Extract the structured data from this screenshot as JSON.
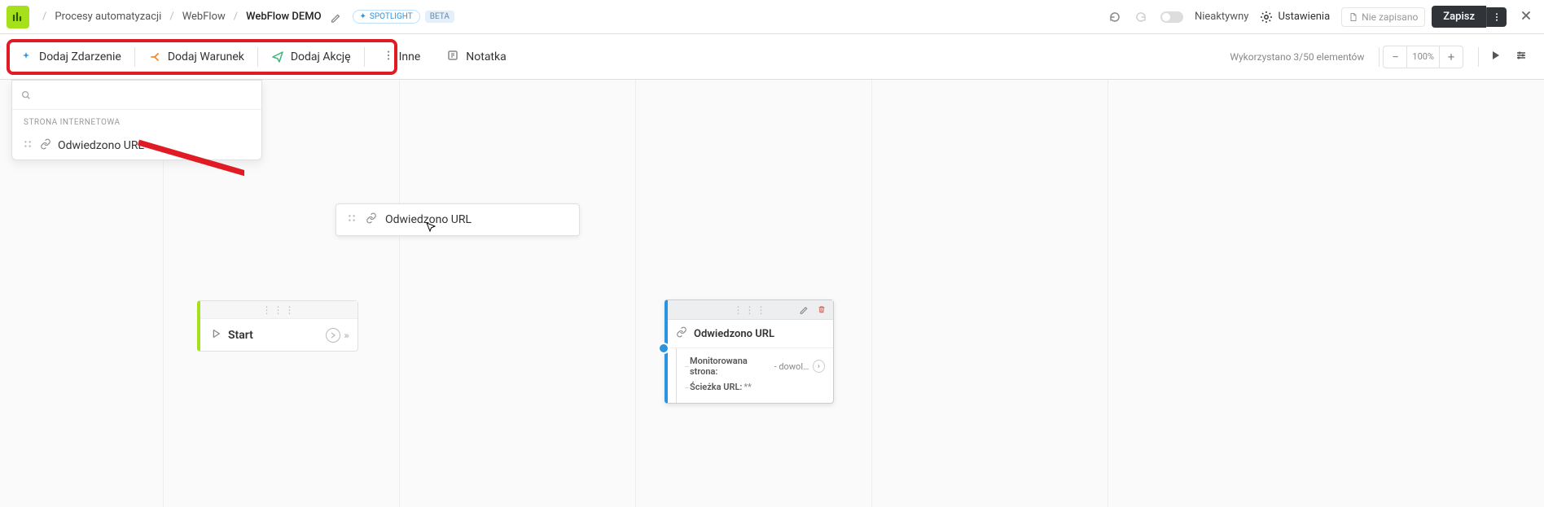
{
  "header": {
    "breadcrumbs": [
      "Procesy automatyzacji",
      "WebFlow",
      "WebFlow DEMO"
    ],
    "spotlight_label": "SPOTLIGHT",
    "beta_label": "BETA",
    "inactive_label": "Nieaktywny",
    "settings_label": "Ustawienia",
    "unsaved_label": "Nie zapisano",
    "save_label": "Zapisz"
  },
  "toolbar": {
    "add_event": "Dodaj Zdarzenie",
    "add_condition": "Dodaj Warunek",
    "add_action": "Dodaj Akcję",
    "other": "Inne",
    "note": "Notatka",
    "usage": "Wykorzystano 3/50 elementów",
    "zoom": "100%"
  },
  "dropdown": {
    "search_placeholder": "",
    "section_title": "STRONA INTERNETOWA",
    "items": [
      {
        "label": "Odwiedzono URL"
      }
    ]
  },
  "ghost_node": {
    "label": "Odwiedzono URL"
  },
  "start_node": {
    "label": "Start"
  },
  "placed_node": {
    "title": "Odwiedzono URL",
    "rows": [
      {
        "key": "Monitorowana strona:",
        "value": "- dowoln..."
      },
      {
        "key": "Ścieżka URL:",
        "value": "**"
      }
    ]
  }
}
